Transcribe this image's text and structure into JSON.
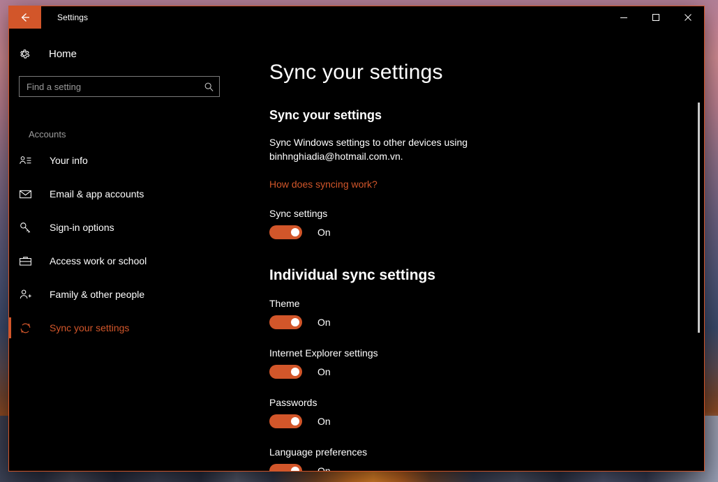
{
  "window": {
    "title": "Settings",
    "back_icon": "back-arrow-icon",
    "minimize_label": "—",
    "maximize_label": "□",
    "close_label": "✕",
    "accent_color": "#d2562a",
    "background_color": "#000000"
  },
  "sidebar": {
    "home_label": "Home",
    "home_icon": "gear-icon",
    "search": {
      "placeholder": "Find a setting",
      "value": "",
      "icon": "search-icon"
    },
    "category_label": "Accounts",
    "items": [
      {
        "label": "Your info",
        "icon": "user-info-icon",
        "selected": false
      },
      {
        "label": "Email & app accounts",
        "icon": "envelope-icon",
        "selected": false
      },
      {
        "label": "Sign-in options",
        "icon": "key-icon",
        "selected": false
      },
      {
        "label": "Access work or school",
        "icon": "briefcase-icon",
        "selected": false
      },
      {
        "label": "Family & other people",
        "icon": "person-add-icon",
        "selected": false
      },
      {
        "label": "Sync your settings",
        "icon": "sync-icon",
        "selected": true
      }
    ]
  },
  "main": {
    "page_title": "Sync your settings",
    "section_header": "Sync your settings",
    "description": "Sync Windows settings to other devices using binhnghiadia@hotmail.com.vn.",
    "help_link": "How does syncing work?",
    "master_toggle": {
      "label": "Sync settings",
      "state": "On",
      "on": true
    },
    "group_header": "Individual sync settings",
    "settings": [
      {
        "label": "Theme",
        "state": "On",
        "on": true
      },
      {
        "label": "Internet Explorer settings",
        "state": "On",
        "on": true
      },
      {
        "label": "Passwords",
        "state": "On",
        "on": true
      },
      {
        "label": "Language preferences",
        "state": "On",
        "on": true
      }
    ]
  }
}
